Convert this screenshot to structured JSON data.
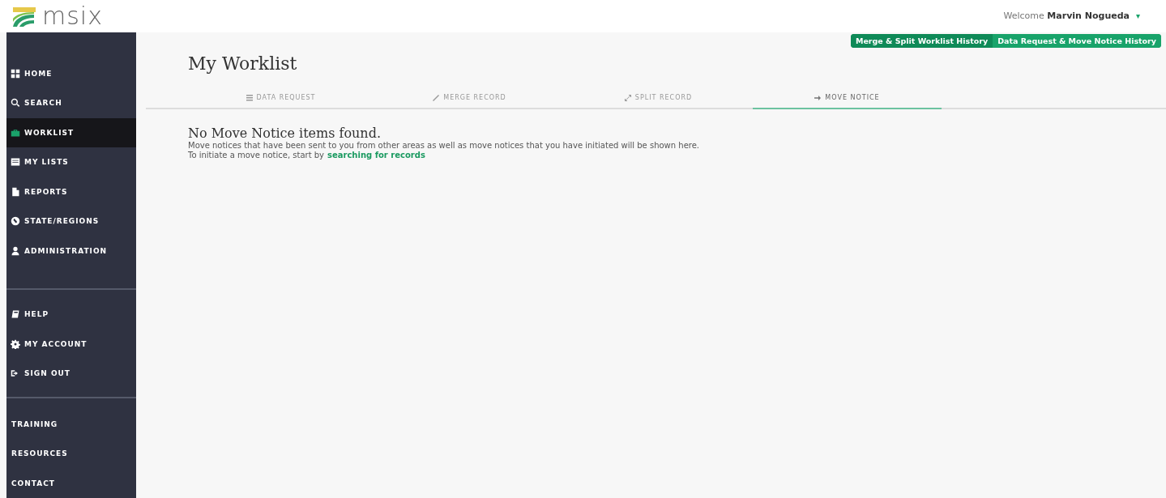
{
  "header": {
    "logo": "msix",
    "welcome": "Welcome **Marvin Nogueda**",
    "caret": "▾"
  },
  "sidebar": {
    "groups": [
      {
        "items": [
          {
            "label": "HOME",
            "icon": true,
            "selected": false
          },
          {
            "label": "SEARCH",
            "icon": true,
            "selected": false
          },
          {
            "label": "WORKLIST",
            "icon": true,
            "selected": true
          },
          {
            "label": "MY LISTS",
            "icon": true,
            "selected": false
          },
          {
            "label": "REPORTS",
            "icon": true,
            "selected": false
          },
          {
            "label": "STATE/REGIONS",
            "icon": true,
            "selected": false
          },
          {
            "label": "ADMINISTRATION",
            "icon": true,
            "selected": false
          }
        ]
      },
      {
        "items": [
          {
            "label": "HELP",
            "icon": true,
            "selected": false
          },
          {
            "label": "MY ACCOUNT",
            "icon": true,
            "selected": false
          },
          {
            "label": "SIGN OUT",
            "icon": true,
            "selected": false
          }
        ]
      },
      {
        "items": [
          {
            "label": "TRAINING",
            "icon": false,
            "selected": false
          },
          {
            "label": "RESOURCES",
            "icon": false,
            "selected": false
          },
          {
            "label": "CONTACT",
            "icon": false,
            "selected": false
          }
        ]
      }
    ]
  },
  "history_buttons": [
    "Merge & Split Worklist History",
    "Data Request & Move Notice History"
  ],
  "page_title": "My Worklist",
  "tabs": [
    {
      "label": "DATA REQUEST",
      "selected": false
    },
    {
      "label": "MERGE RECORD",
      "selected": false
    },
    {
      "label": "SPLIT RECORD",
      "selected": false
    },
    {
      "label": "MOVE NOTICE",
      "selected": true
    }
  ],
  "empty_state": {
    "heading": "No Move Notice items found.",
    "text": "Move notices that have been sent to you from other areas as well as move notices that you have initiated will be shown here.",
    "prompt": "To initiate a move notice, start by",
    "link": "searching for records"
  }
}
